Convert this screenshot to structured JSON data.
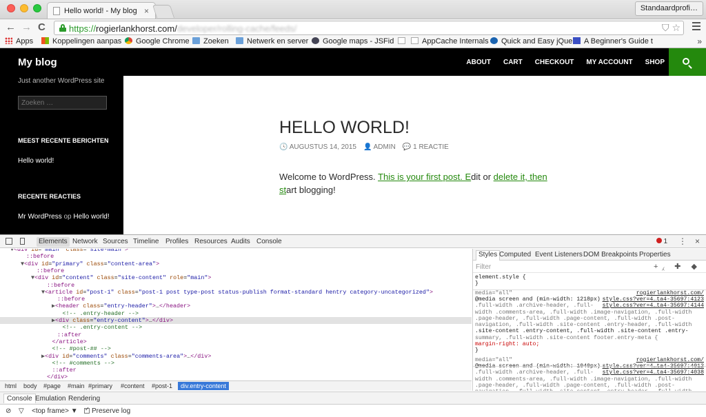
{
  "browser": {
    "tab_title": "Hello world! - My blog",
    "tab_close": "×",
    "profile_name": "Standaardprofi…",
    "url_scheme": "https://",
    "url_host": "rogierlankhorst.com/",
    "url_path": "developer/rolling-cache/feeds/",
    "back": "←",
    "forward": "→",
    "reload": "C",
    "shield": "⛉",
    "star": "☆",
    "bookmarks": [
      {
        "label": "Apps",
        "icon": "apps-icon"
      },
      {
        "label": "Koppelingen aanpas",
        "icon": "windows-icon"
      },
      {
        "label": "Google Chrome",
        "icon": "chrome-icon"
      },
      {
        "label": "Zoeken",
        "icon": "folder-icon"
      },
      {
        "label": "Netwerk en server",
        "icon": "folder-icon"
      },
      {
        "label": "Google maps - JSFid",
        "icon": "jsfiddle-icon"
      },
      {
        "label": "",
        "icon": "page-icon"
      },
      {
        "label": "AppCache Internals",
        "icon": "page-icon"
      },
      {
        "label": "Quick and Easy jQue",
        "icon": "jquery-icon"
      },
      {
        "label": "A Beginner's Guide t",
        "icon": "css-icon"
      }
    ],
    "bookmarks_more": "»"
  },
  "site": {
    "title": "My blog",
    "tagline": "Just another WordPress site",
    "menu": [
      "ABOUT",
      "CART",
      "CHECKOUT",
      "MY ACCOUNT",
      "SHOP"
    ],
    "search_placeholder": "Zoeken …",
    "widget_recent_posts_title": "MEEST RECENTE BERICHTEN",
    "recent_post": "Hello world!",
    "widget_recent_comments_title": "RECENTE REACTIES",
    "recent_comment_author": "Mr WordPress",
    "recent_comment_on": " op ",
    "recent_comment_post": "Hello world!"
  },
  "post": {
    "title": "HELLO WORLD!",
    "date": "AUGUSTUS 14, 2015",
    "author": "ADMIN",
    "comments": "1 REACTIE",
    "body_start": "Welcome to WordPress. ",
    "link_first_post": "This is your first post. E",
    "body_mid": "dit or ",
    "link_delete": "delete it, then",
    "body_link_start": "st",
    "body_end": "art blogging!"
  },
  "devtools": {
    "tabs": [
      "Elements",
      "Network",
      "Sources",
      "Timeline",
      "Profiles",
      "Resources",
      "Audits",
      "Console"
    ],
    "active_tab": "Elements",
    "error_count": "1",
    "dom_lines": [
      {
        "t": "▼",
        "h": "<div id=\"main\" class=\"site-main\">",
        "i": 2
      },
      {
        "t": "",
        "h": "::before",
        "i": 4
      },
      {
        "t": "▼",
        "h": "<div id=\"primary\" class=\"content-area\">",
        "i": 4
      },
      {
        "t": "",
        "h": "::before",
        "i": 6
      },
      {
        "t": "▼",
        "h": "<div id=\"content\" class=\"site-content\" role=\"main\">",
        "i": 6
      },
      {
        "t": "",
        "h": "::before",
        "i": 8
      },
      {
        "t": "▼",
        "h": "<article id=\"post-1\" class=\"post-1 post type-post status-publish format-standard hentry category-uncategorized\">",
        "i": 8
      },
      {
        "t": "",
        "h": "::before",
        "i": 10
      },
      {
        "t": "▶",
        "h": "<header class=\"entry-header\">…</header>",
        "i": 10
      },
      {
        "t": "",
        "h": "<!-- .entry-header -->",
        "i": 11
      },
      {
        "t": "▶",
        "h": "<div class=\"entry-content\">…</div>",
        "i": 10
      },
      {
        "t": "",
        "h": "<!-- .entry-content -->",
        "i": 11
      },
      {
        "t": "",
        "h": "::after",
        "i": 10
      },
      {
        "t": "",
        "h": "</article>",
        "i": 9
      },
      {
        "t": "",
        "h": "<!-- #post-## -->",
        "i": 9
      },
      {
        "t": "▶",
        "h": "<div id=\"comments\" class=\"comments-area\">…</div>",
        "i": 8
      },
      {
        "t": "",
        "h": "<!-- #comments -->",
        "i": 9
      },
      {
        "t": "",
        "h": "::after",
        "i": 9
      },
      {
        "t": "",
        "h": "</div>",
        "i": 8
      },
      {
        "t": "",
        "h": "<!-- #content -->",
        "i": 7
      },
      {
        "t": "",
        "h": "::after",
        "i": 7
      }
    ],
    "selected_line": 10,
    "breadcrumbs": [
      "html",
      "body",
      "#page",
      "#main",
      "#primary",
      "#content",
      "#post-1",
      "div.entry-content"
    ],
    "styles_tabs": [
      "Styles",
      "Computed",
      "Event Listeners",
      "DOM Breakpoints",
      "Properties"
    ],
    "filter_placeholder": "Filter",
    "filter_tools": "+⁁ ✚ ◆",
    "css_lines": [
      {
        "text": "element.style {",
        "src": ""
      },
      {
        "text": "}",
        "src": ""
      },
      {
        "text": "media=\"all\"",
        "src": "rogierlankhorst.com/",
        "dim": true
      },
      {
        "text": "@media screen and (min-width: 1218px)",
        "src": "style.css?ver=4…ta4-35697:4123"
      },
      {
        "text": ".full-width .archive-header, .full-",
        "src": "style.css?ver=4…ta4-35697:4144",
        "dim": true
      },
      {
        "text": "width .comments-area, .full-width .image-navigation, .full-width",
        "src": "",
        "dim": true
      },
      {
        "text": ".page-header, .full-width .page-content, .full-width .post-",
        "src": "",
        "dim": true
      },
      {
        "text": "navigation, .full-width .site-content .entry-header, .full-width",
        "src": "",
        "dim": true
      },
      {
        "text": ".site-content .entry-content, .full-width .site-content .entry-",
        "src": ""
      },
      {
        "text": "summary, .full-width .site-content footer.entry-meta {",
        "src": "",
        "dim": true
      },
      {
        "text": "  margin-right: auto;",
        "src": "",
        "prop": true
      },
      {
        "text": "}",
        "src": ""
      },
      {
        "text": "media=\"all\"",
        "src": "rogierlankhorst.com/",
        "dim": true
      },
      {
        "text": "@media screen and (min-width: 1040px)",
        "src": "style.css?ver=4…ta4-35697:4012"
      },
      {
        "text": ".full-width .archive-header, .full-",
        "src": "style.css?ver=4…ta4-35697:4038",
        "dim": true
      },
      {
        "text": "width .comments-area, .full-width .image-navigation, .full-width",
        "src": "",
        "dim": true
      },
      {
        "text": ".page-header, .full-width .page-content, .full-width .post-",
        "src": "",
        "dim": true
      },
      {
        "text": "navigation, .full-width .site-content .entry-header, .full-width",
        "src": "",
        "dim": true
      }
    ],
    "drawer_tabs": [
      "Console",
      "Emulation",
      "Rendering"
    ],
    "frame_select": "<top frame>",
    "frame_arrow": "▼",
    "preserve_log": "Preserve log"
  },
  "colors": {
    "accent_green": "#24890d",
    "devtools_selection": "#3879d9"
  }
}
